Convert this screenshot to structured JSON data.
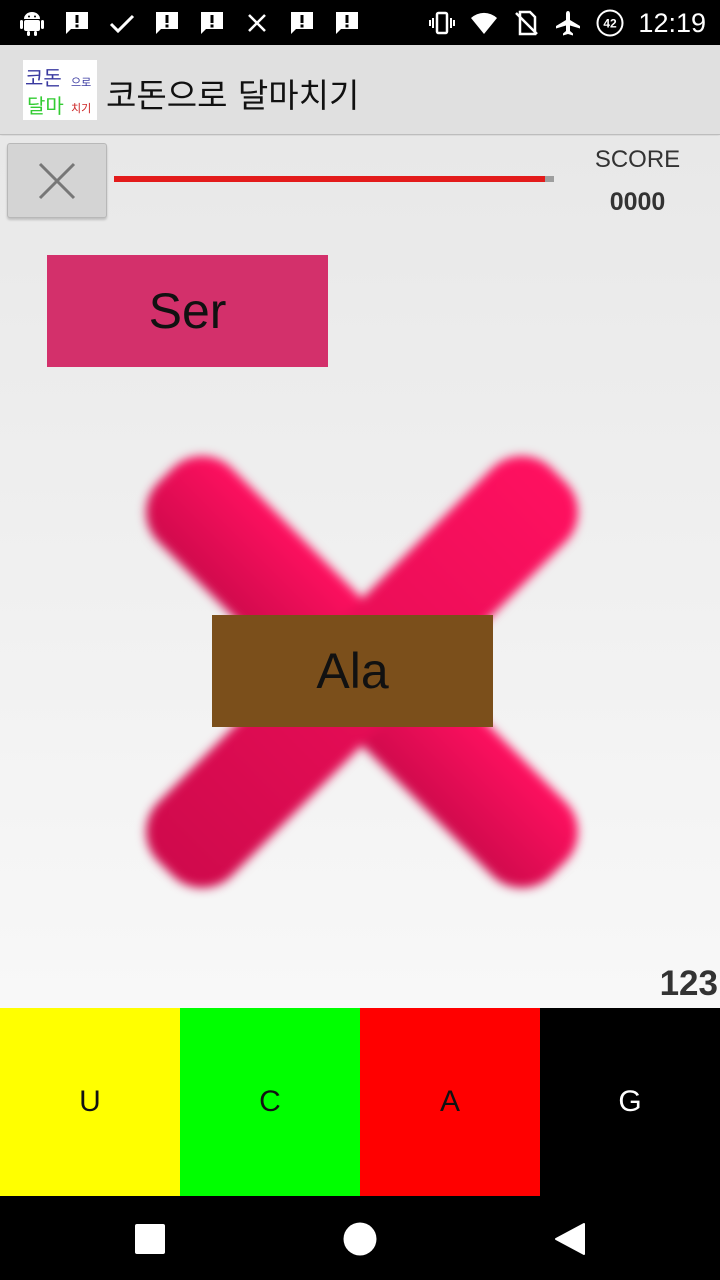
{
  "status_bar": {
    "time": "12:19",
    "battery_level": "42",
    "icons_left": [
      "android-icon",
      "alert-icon",
      "check-icon",
      "alert-icon",
      "alert-icon",
      "close-icon",
      "alert-icon",
      "alert-icon"
    ],
    "icons_right": [
      "vibrate-icon",
      "wifi-icon",
      "no-sim-icon",
      "airplane-icon",
      "battery-icon"
    ]
  },
  "app_bar": {
    "title": "코돈으로 달마치기",
    "logo": {
      "line1": "코돈",
      "line1_small": "으로",
      "line2": "달마",
      "line2_small": "치기"
    }
  },
  "game": {
    "score_label": "SCORE",
    "score_value": "0000",
    "progress": 0.98,
    "card_top": "Ser",
    "card_bottom": "Ala",
    "counter": "123",
    "wrong_mark": "x-mark-icon"
  },
  "keys": [
    {
      "label": "U",
      "bg": "#ffff00",
      "fg": "#111111"
    },
    {
      "label": "C",
      "bg": "#00ff00",
      "fg": "#111111"
    },
    {
      "label": "A",
      "bg": "#ff0000",
      "fg": "#111111"
    },
    {
      "label": "G",
      "bg": "#000000",
      "fg": "#ffffff"
    }
  ],
  "nav": [
    "recents-icon",
    "home-icon",
    "back-icon"
  ],
  "colors": {
    "card_top": "#d3306b",
    "card_bottom": "#7b4f1b",
    "x_mark": "#ea0a58",
    "progress": "#e31b1b"
  }
}
